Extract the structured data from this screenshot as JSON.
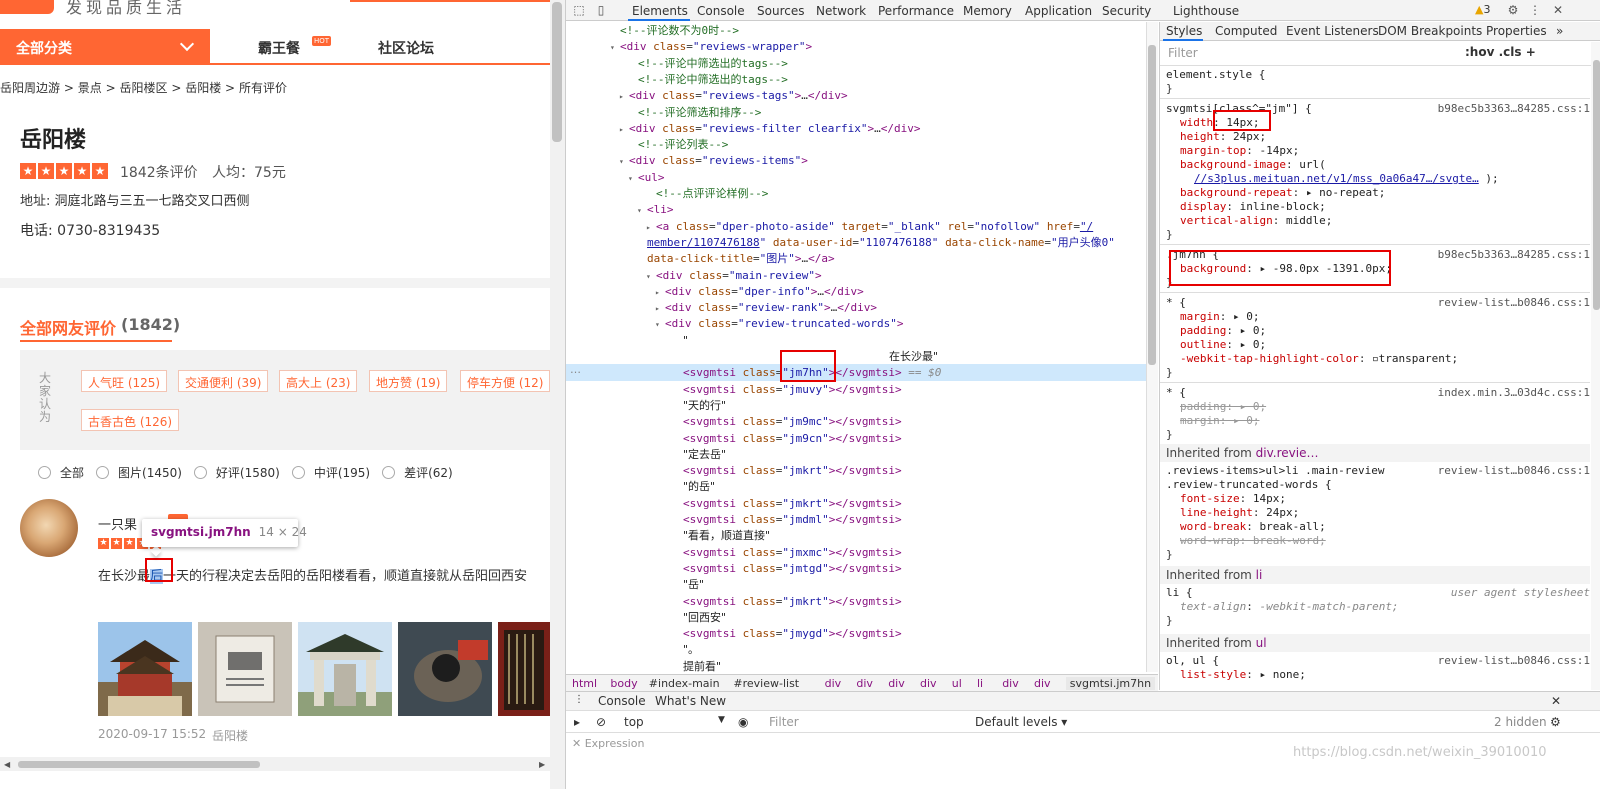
{
  "page": {
    "slogan": "发现品质生活",
    "nav": {
      "all_categories": "全部分类",
      "item1": "霸王餐",
      "hot": "HOT",
      "item2": "社区论坛"
    },
    "breadcrumb": [
      "岳阳周边游",
      ">",
      "景点",
      ">",
      "岳阳楼区",
      ">",
      "岳阳楼",
      ">",
      "所有评价"
    ],
    "poi": {
      "title": "岳阳楼",
      "rating_stars": 5,
      "review_count": "1842条评价",
      "avg_price": "人均：75元",
      "address": "地址: 洞庭北路与三五一七路交叉口西侧",
      "phone": "电话: 0730-8319435"
    },
    "reviews_header": {
      "label": "全部网友评价",
      "count": "(1842)"
    },
    "tags_label": "大家认为",
    "tags": [
      "人气旺 (125)",
      "交通便利 (39)",
      "高大上 (23)",
      "地方赞 (19)",
      "停车方便 (12)",
      "古香古色 (126)"
    ],
    "filters": [
      "全部",
      "图片(1450)",
      "好评(1580)",
      "中评(195)",
      "差评(62)"
    ],
    "review": {
      "user": "一只果",
      "rating_stars": 5,
      "text_before": "在长沙最",
      "text_highlight": "后",
      "text_after": "一天的行程决定去岳阳的岳阳楼看看，顺道直接就从岳阳回西安",
      "date": "2020-09-17 15:52",
      "poi": "岳阳楼"
    },
    "tooltip": {
      "selector": "svgmtsi.jm7hn",
      "size": "14 × 24"
    }
  },
  "devtools": {
    "tabs": [
      "Elements",
      "Console",
      "Sources",
      "Network",
      "Performance",
      "Memory",
      "Application",
      "Security",
      "Lighthouse"
    ],
    "active_tab": "Elements",
    "warnings": "3",
    "dom_lines": [
      {
        "indent": 6,
        "html": "<span class='cmt'>&lt;!--评论数不为0时--&gt;</span>"
      },
      {
        "indent": 6,
        "tw": "▾",
        "html": "<span class='tag-n'>&lt;div</span> <span class='att-n'>class</span>=<span class='att-v'>\"reviews-wrapper\"</span><span class='tag-n'>&gt;</span>"
      },
      {
        "indent": 8,
        "html": "<span class='cmt'>&lt;!--评论中筛选出的tags--&gt;</span>"
      },
      {
        "indent": 8,
        "html": "<span class='cmt'>&lt;!--评论中筛选出的tags--&gt;</span>"
      },
      {
        "indent": 7,
        "tw": "▸",
        "html": "<span class='tag-n'>&lt;div</span> <span class='att-n'>class</span>=<span class='att-v'>\"reviews-tags\"</span><span class='tag-n'>&gt;</span>…<span class='tag-n'>&lt;/div&gt;</span>"
      },
      {
        "indent": 8,
        "html": "<span class='cmt'>&lt;!--评论筛选和排序--&gt;</span>"
      },
      {
        "indent": 7,
        "tw": "▸",
        "html": "<span class='tag-n'>&lt;div</span> <span class='att-n'>class</span>=<span class='att-v'>\"reviews-filter clearfix\"</span><span class='tag-n'>&gt;</span>…<span class='tag-n'>&lt;/div&gt;</span>"
      },
      {
        "indent": 8,
        "html": "<span class='cmt'>&lt;!--评论列表--&gt;</span>"
      },
      {
        "indent": 7,
        "tw": "▾",
        "html": "<span class='tag-n'>&lt;div</span> <span class='att-n'>class</span>=<span class='att-v'>\"reviews-items\"</span><span class='tag-n'>&gt;</span>"
      },
      {
        "indent": 8,
        "tw": "▾",
        "html": "<span class='tag-n'>&lt;ul&gt;</span>"
      },
      {
        "indent": 10,
        "html": "<span class='cmt'>&lt;!--点评评论样例--&gt;</span>"
      },
      {
        "indent": 9,
        "tw": "▾",
        "html": "<span class='tag-n'>&lt;li&gt;</span>"
      },
      {
        "indent": 10,
        "tw": "▸",
        "html": "<span class='tag-n'>&lt;a</span> <span class='att-n'>class</span>=<span class='att-v'>\"dper-photo-aside\"</span> <span class='att-n'>target</span>=<span class='att-v'>\"_blank\"</span> <span class='att-n'>rel</span>=<span class='att-v'>\"nofollow\"</span> <span class='att-n'>href</span>=<span class='att-v link'>\"/</span>"
      },
      {
        "indent": 9,
        "html": "<span class='att-v link'>member/1107476188</span><span class='att-v'>\"</span> <span class='att-n'>data-user-id</span>=<span class='att-v'>\"1107476188\"</span> <span class='att-n'>data-click-name</span>=<span class='att-v'>\"用户头像0\"</span>"
      },
      {
        "indent": 9,
        "html": "<span class='att-n'>data-click-title</span>=<span class='att-v'>\"图片\"</span><span class='tag-n'>&gt;</span>…<span class='tag-n'>&lt;/a&gt;</span>"
      },
      {
        "indent": 10,
        "tw": "▾",
        "html": "<span class='tag-n'>&lt;div</span> <span class='att-n'>class</span>=<span class='att-v'>\"main-review\"</span><span class='tag-n'>&gt;</span>"
      },
      {
        "indent": 11,
        "tw": "▸",
        "html": "<span class='tag-n'>&lt;div</span> <span class='att-n'>class</span>=<span class='att-v'>\"dper-info\"</span><span class='tag-n'>&gt;</span>…<span class='tag-n'>&lt;/div&gt;</span>"
      },
      {
        "indent": 11,
        "tw": "▸",
        "html": "<span class='tag-n'>&lt;div</span> <span class='att-n'>class</span>=<span class='att-v'>\"review-rank\"</span><span class='tag-n'>&gt;</span>…<span class='tag-n'>&lt;/div&gt;</span>"
      },
      {
        "indent": 11,
        "tw": "▾",
        "html": "<span class='tag-n'>&lt;div</span> <span class='att-n'>class</span>=<span class='att-v'>\"review-truncated-words\"</span><span class='tag-n'>&gt;</span>"
      },
      {
        "indent": 13,
        "html": "<span class='txt'>\"</span>"
      },
      {
        "indent": 13,
        "html": "<span class='txt' style='padding-left:206px'>在长沙最\"</span>"
      },
      {
        "indent": 13,
        "sel": true,
        "html": "<span class='tag-n'>&lt;svgmtsi</span> <span class='att-n'>class</span>=<span class='att-v'>\"jm7hn\"</span><span class='tag-n'>&gt;&lt;/svgmtsi&gt;</span> <span class='dollar'>== $0</span>"
      },
      {
        "indent": 13,
        "html": "<span class='tag-n'>&lt;svgmtsi</span> <span class='att-n'>class</span>=<span class='att-v'>\"jmuvy\"</span><span class='tag-n'>&gt;&lt;/svgmtsi&gt;</span>"
      },
      {
        "indent": 13,
        "html": "<span class='txt'>\"天的行\"</span>"
      },
      {
        "indent": 13,
        "html": "<span class='tag-n'>&lt;svgmtsi</span> <span class='att-n'>class</span>=<span class='att-v'>\"jm9mc\"</span><span class='tag-n'>&gt;&lt;/svgmtsi&gt;</span>"
      },
      {
        "indent": 13,
        "html": "<span class='tag-n'>&lt;svgmtsi</span> <span class='att-n'>class</span>=<span class='att-v'>\"jm9cn\"</span><span class='tag-n'>&gt;&lt;/svgmtsi&gt;</span>"
      },
      {
        "indent": 13,
        "html": "<span class='txt'>\"定去岳\"</span>"
      },
      {
        "indent": 13,
        "html": "<span class='tag-n'>&lt;svgmtsi</span> <span class='att-n'>class</span>=<span class='att-v'>\"jmkrt\"</span><span class='tag-n'>&gt;&lt;/svgmtsi&gt;</span>"
      },
      {
        "indent": 13,
        "html": "<span class='txt'>\"的岳\"</span>"
      },
      {
        "indent": 13,
        "html": "<span class='tag-n'>&lt;svgmtsi</span> <span class='att-n'>class</span>=<span class='att-v'>\"jmkrt\"</span><span class='tag-n'>&gt;&lt;/svgmtsi&gt;</span>"
      },
      {
        "indent": 13,
        "html": "<span class='tag-n'>&lt;svgmtsi</span> <span class='att-n'>class</span>=<span class='att-v'>\"jmdml\"</span><span class='tag-n'>&gt;&lt;/svgmtsi&gt;</span>"
      },
      {
        "indent": 13,
        "html": "<span class='txt'>\"看看，顺道直接\"</span>"
      },
      {
        "indent": 13,
        "html": "<span class='tag-n'>&lt;svgmtsi</span> <span class='att-n'>class</span>=<span class='att-v'>\"jmxmc\"</span><span class='tag-n'>&gt;&lt;/svgmtsi&gt;</span>"
      },
      {
        "indent": 13,
        "html": "<span class='tag-n'>&lt;svgmtsi</span> <span class='att-n'>class</span>=<span class='att-v'>\"jmtgd\"</span><span class='tag-n'>&gt;&lt;/svgmtsi&gt;</span>"
      },
      {
        "indent": 13,
        "html": "<span class='txt'>\"岳\"</span>"
      },
      {
        "indent": 13,
        "html": "<span class='tag-n'>&lt;svgmtsi</span> <span class='att-n'>class</span>=<span class='att-v'>\"jmkrt\"</span><span class='tag-n'>&gt;&lt;/svgmtsi&gt;</span>"
      },
      {
        "indent": 13,
        "html": "<span class='txt'>\"回西安\"</span>"
      },
      {
        "indent": 13,
        "html": "<span class='tag-n'>&lt;svgmtsi</span> <span class='att-n'>class</span>=<span class='att-v'>\"jmygd\"</span><span class='tag-n'>&gt;&lt;/svgmtsi&gt;</span>"
      },
      {
        "indent": 13,
        "html": "<span class='txt'>\"。</span>"
      },
      {
        "indent": 13,
        "html": "<span class='txt'>提前看\"</span>"
      }
    ],
    "breadcrumb": [
      "html",
      "body",
      "#index-main",
      "#review-list",
      "div",
      "div",
      "div",
      "div",
      "ul",
      "li",
      "div",
      "div",
      "svgmtsi.jm7hn"
    ],
    "styles": {
      "tabs": [
        "Styles",
        "Computed",
        "Event Listeners",
        "DOM Breakpoints",
        "Properties"
      ],
      "filter_placeholder": "Filter",
      "filter_buttons": ":hov  .cls  +"
    },
    "drawer_tabs": [
      "Console",
      "What's New"
    ],
    "console": {
      "context": "top",
      "filter_placeholder": "Filter",
      "levels": "Default levels ▾",
      "hidden": "2 hidden",
      "expression": "Expression"
    },
    "watermark": "https://blog.csdn.net/weixin_39010010"
  }
}
